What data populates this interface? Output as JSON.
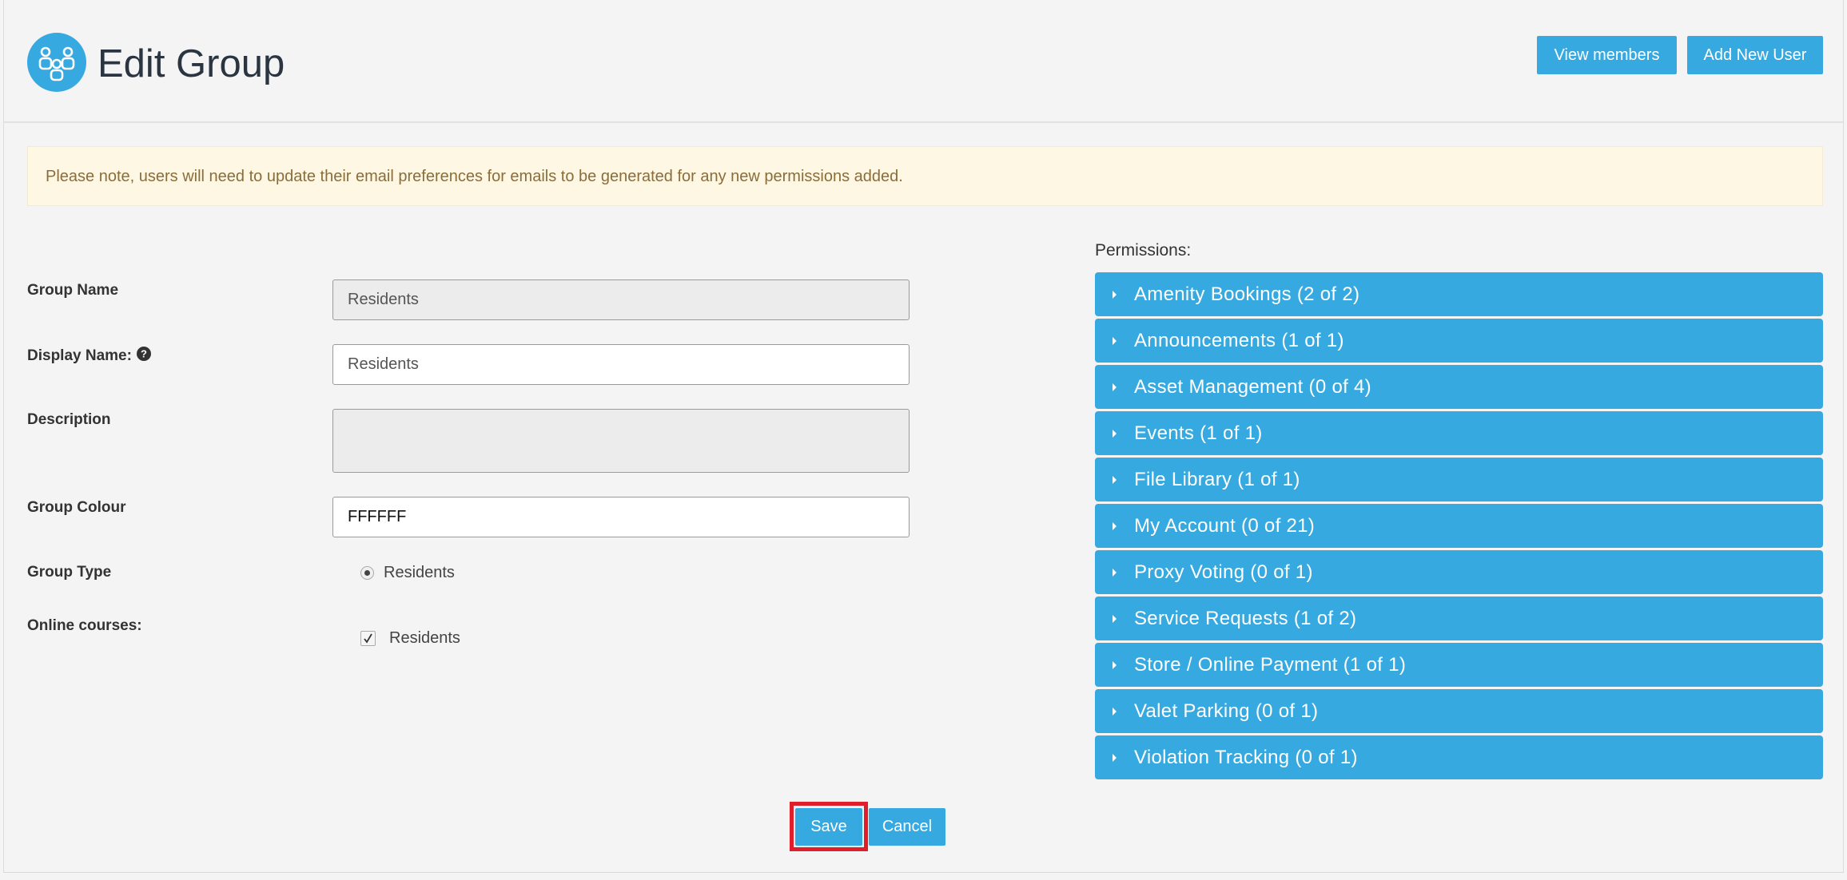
{
  "header": {
    "title": "Edit Group",
    "view_members_label": "View members",
    "add_user_label": "Add New User",
    "accent": "#36a9e1"
  },
  "notice": {
    "text": "Please note, users will need to update their email preferences for emails to be generated for any new permissions added."
  },
  "form": {
    "group_name": {
      "label": "Group Name",
      "value": "Residents"
    },
    "display_name": {
      "label": "Display Name:",
      "value": "Residents",
      "help_icon": "question-circle-icon"
    },
    "description": {
      "label": "Description",
      "value": ""
    },
    "group_colour": {
      "label": "Group Colour",
      "value": "FFFFFF"
    },
    "group_type": {
      "label": "Group Type",
      "option": "Residents",
      "selected": true
    },
    "online_courses": {
      "label": "Online courses:",
      "option": "Residents",
      "checked": true
    }
  },
  "permissions": {
    "title": "Permissions:",
    "items": [
      {
        "label": "Amenity Bookings (2 of 2)"
      },
      {
        "label": "Announcements (1 of 1)"
      },
      {
        "label": "Asset Management (0 of 4)"
      },
      {
        "label": "Events (1 of 1)"
      },
      {
        "label": "File Library (1 of 1)"
      },
      {
        "label": "My Account (0 of 21)"
      },
      {
        "label": "Proxy Voting (0 of 1)"
      },
      {
        "label": "Service Requests (1 of 2)"
      },
      {
        "label": "Store / Online Payment (1 of 1)"
      },
      {
        "label": "Valet Parking (0 of 1)"
      },
      {
        "label": "Violation Tracking (0 of 1)"
      }
    ]
  },
  "footer": {
    "save_label": "Save",
    "cancel_label": "Cancel",
    "highlight_color": "#e01d2a"
  }
}
